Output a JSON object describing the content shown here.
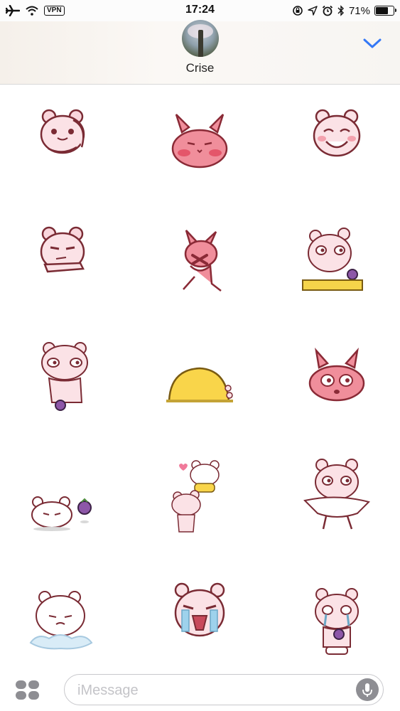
{
  "status_bar": {
    "time": "17:24",
    "vpn_label": "VPN",
    "battery_percent_text": "71%",
    "battery_level": 0.71,
    "icons": [
      "airplane-icon",
      "wifi-icon",
      "orientation-lock-icon",
      "location-icon",
      "alarm-icon",
      "bluetooth-icon",
      "battery-icon"
    ]
  },
  "header": {
    "contact_name": "Crise",
    "collapse_icon": "chevron-down-icon",
    "accent_color": "#3478f6"
  },
  "stickers": [
    {
      "name": "pink-bear-thinking",
      "color": "#f9d6dc"
    },
    {
      "name": "pink-bunny-blushing",
      "color": "#f08e9b"
    },
    {
      "name": "pink-bear-smiling",
      "color": "#fbe2e6"
    },
    {
      "name": "pink-bear-smug",
      "color": "#f9d6dc"
    },
    {
      "name": "pink-bunny-dancing",
      "color": "#f08e9b"
    },
    {
      "name": "pink-bear-at-table",
      "color": "#fbe2e6"
    },
    {
      "name": "pink-bear-holding-fruit",
      "color": "#fbe2e6"
    },
    {
      "name": "yellow-blanket-lump",
      "color": "#f9d54a"
    },
    {
      "name": "pink-bunny-glasses",
      "color": "#f08e9b"
    },
    {
      "name": "white-bear-lying-with-fruit",
      "color": "#ffffff"
    },
    {
      "name": "bears-stacked-hearts",
      "color": "#fbe2e6"
    },
    {
      "name": "pink-bear-waving-diaper",
      "color": "#fbe2e6"
    },
    {
      "name": "white-bear-sad-cloud",
      "color": "#ffffff"
    },
    {
      "name": "pink-bear-crying-loud",
      "color": "#fbe2e6"
    },
    {
      "name": "pink-bear-crying-hug",
      "color": "#fbe2e6"
    }
  ],
  "compose_bar": {
    "apps_icon": "app-drawer-icon",
    "placeholder": "iMessage",
    "mic_icon": "microphone-icon"
  }
}
